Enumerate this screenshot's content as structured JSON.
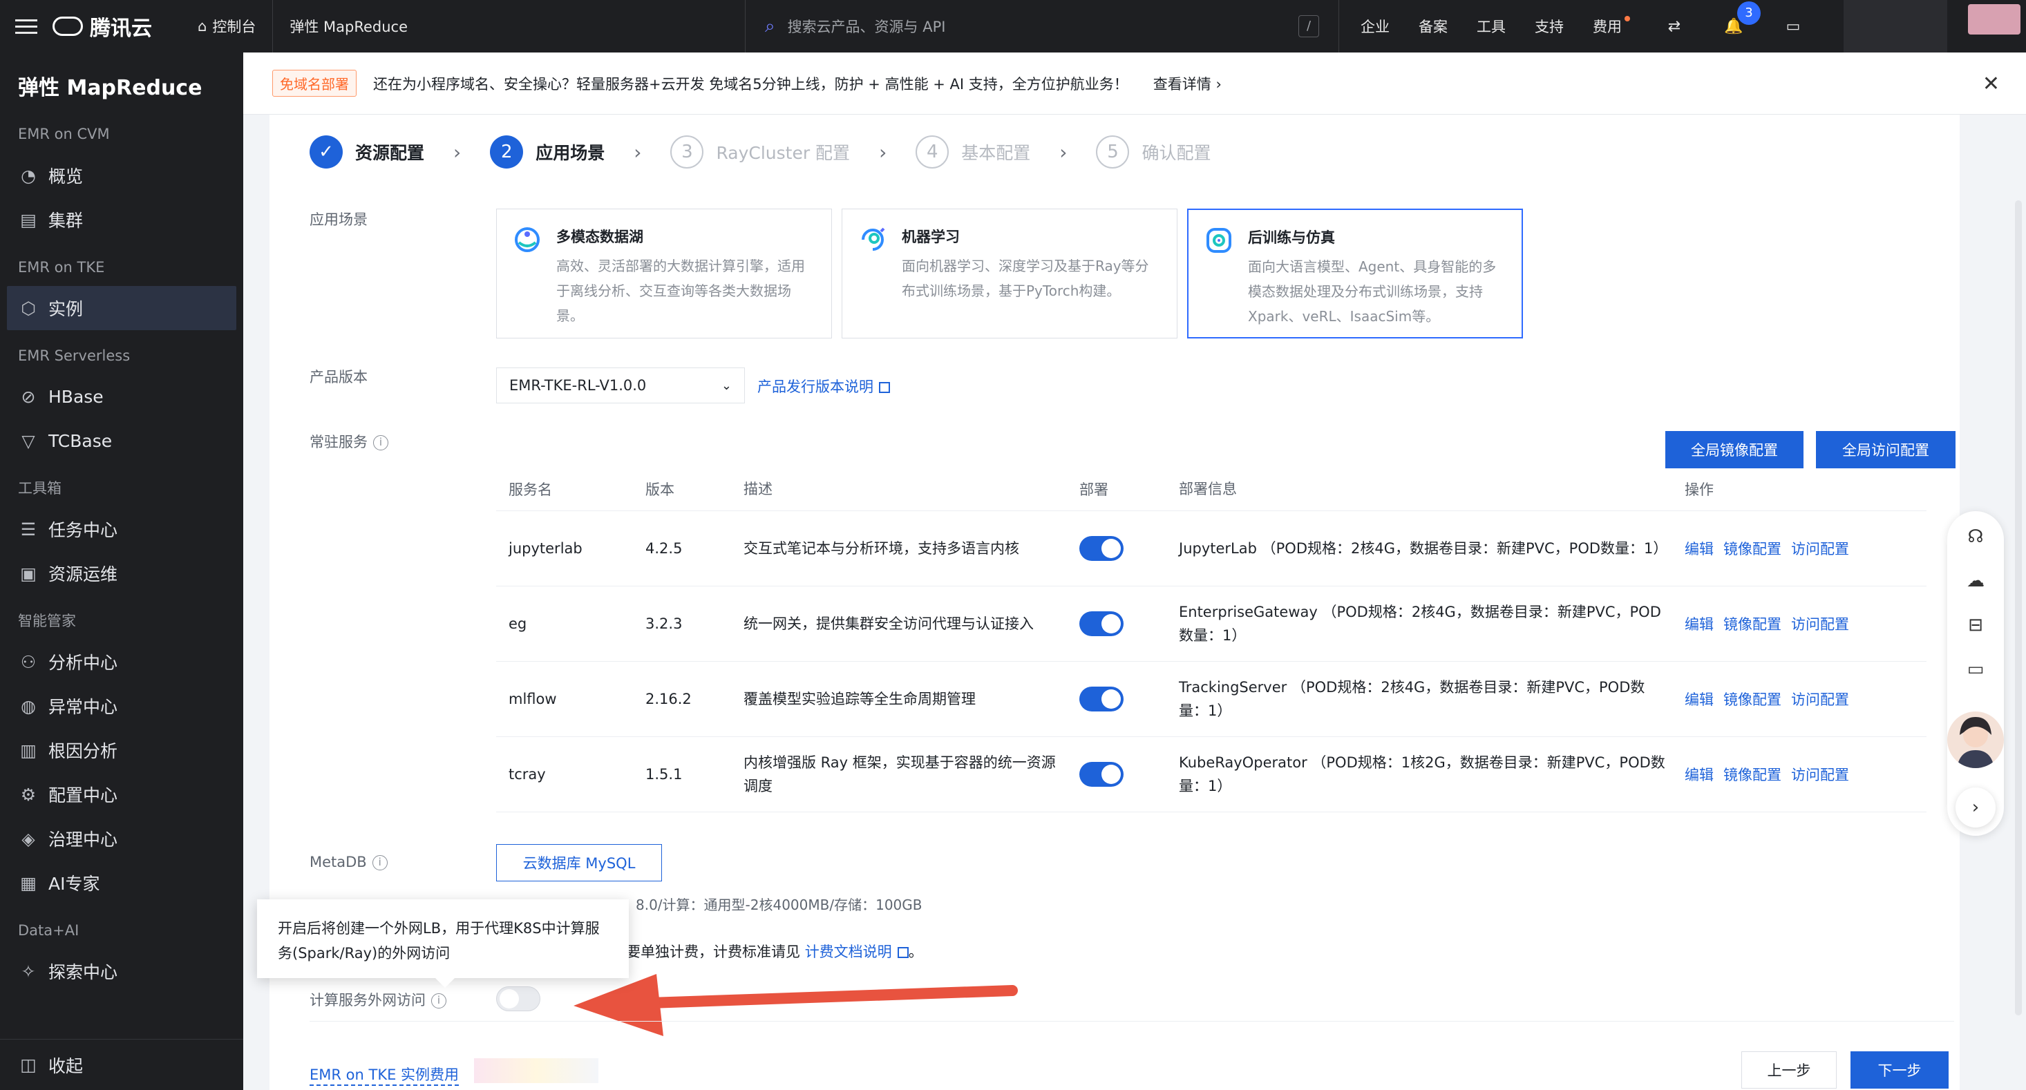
{
  "topbar": {
    "brand": "腾讯云",
    "console": "控制台",
    "product": "弹性 MapReduce",
    "search_placeholder": "搜索云产品、资源与 API",
    "shortcut": "/",
    "nav": [
      "企业",
      "备案",
      "工具",
      "支持",
      "费用"
    ],
    "notifications_count": "3"
  },
  "sidebar": {
    "title": "弹性 MapReduce",
    "groups": [
      {
        "label": "EMR on CVM",
        "items": [
          "概览",
          "集群"
        ]
      },
      {
        "label": "EMR on TKE",
        "items": [
          "实例"
        ]
      },
      {
        "label": "EMR Serverless",
        "items": [
          "HBase",
          "TCBase"
        ]
      },
      {
        "label": "工具箱",
        "items": [
          "任务中心",
          "资源运维"
        ]
      },
      {
        "label": "智能管家",
        "items": [
          "分析中心",
          "异常中心",
          "根因分析",
          "配置中心",
          "治理中心",
          "AI专家"
        ]
      },
      {
        "label": "Data+AI",
        "items": [
          "探索中心"
        ]
      }
    ],
    "collapse": "收起"
  },
  "notice": {
    "tag": "免域名部署",
    "text": "还在为小程序域名、安全操心？轻量服务器+云开发 免域名5分钟上线，防护 + 高性能 + AI 支持，全方位护航业务！",
    "more": "查看详情"
  },
  "steps": [
    {
      "num": "1",
      "label": "资源配置",
      "state": "done"
    },
    {
      "num": "2",
      "label": "应用场景",
      "state": "current"
    },
    {
      "num": "3",
      "label": "RayCluster 配置",
      "state": "todo"
    },
    {
      "num": "4",
      "label": "基本配置",
      "state": "todo"
    },
    {
      "num": "5",
      "label": "确认配置",
      "state": "todo"
    }
  ],
  "form": {
    "scene_label": "应用场景",
    "scenes": [
      {
        "title": "多模态数据湖",
        "desc": "高效、灵活部署的大数据计算引擎，适用于离线分析、交互查询等各类大数据场景。"
      },
      {
        "title": "机器学习",
        "desc": "面向机器学习、深度学习及基于Ray等分布式训练场景，基于PyTorch构建。"
      },
      {
        "title": "后训练与仿真",
        "desc": "面向大语言模型、Agent、具身智能的多模态数据处理及分布式训练场景，支持Xpark、veRL、IsaacSim等。"
      }
    ],
    "version_label": "产品版本",
    "version_value": "EMR-TKE-RL-V1.0.0",
    "version_link": "产品发行版本说明",
    "services_label": "常驻服务",
    "btn_global_image": "全局镜像配置",
    "btn_global_access": "全局访问配置",
    "table_headers": [
      "服务名",
      "版本",
      "描述",
      "部署",
      "部署信息",
      "操作"
    ],
    "services": [
      {
        "name": "jupyterlab",
        "version": "4.2.5",
        "desc": "交互式笔记本与分析环境，支持多语言内核",
        "info": "JupyterLab （POD规格：2核4G，数据卷目录：新建PVC，POD数量：1）"
      },
      {
        "name": "eg",
        "version": "3.2.3",
        "desc": "统一网关，提供集群安全访问代理与认证接入",
        "info": "EnterpriseGateway （POD规格：2核4G，数据卷目录：新建PVC，POD数量：1）"
      },
      {
        "name": "mlflow",
        "version": "2.16.2",
        "desc": "覆盖模型实验追踪等全生命周期管理",
        "info": "TrackingServer （POD规格：2核4G，数据卷目录：新建PVC，POD数量：1）"
      },
      {
        "name": "tcray",
        "version": "1.5.1",
        "desc": "内核增强版 Ray 框架，实现基于容器的统一资源调度",
        "info": "KubeRayOperator （POD规格：1核2G，数据卷目录：新建PVC，POD数量：1）"
      }
    ],
    "ops": [
      "编辑",
      "镜像配置",
      "访问配置"
    ],
    "metadb_label": "MetaDB",
    "metadb_button": "云数据库 MySQL",
    "metadb_spec": "8.0/计算：通用型-2核4000MB/存储：100GB",
    "billing_text": "要单独计费，计费标准请见",
    "billing_link": "计费文档说明",
    "billing_end": "。",
    "external_label": "计算服务外网访问",
    "tooltip": "开启后将创建一个外网LB，用于代理K8S中计算服务(Spark/Ray)的外网访问",
    "fee_link": "EMR on TKE 实例费用",
    "btn_prev": "上一步",
    "btn_next": "下一步"
  }
}
